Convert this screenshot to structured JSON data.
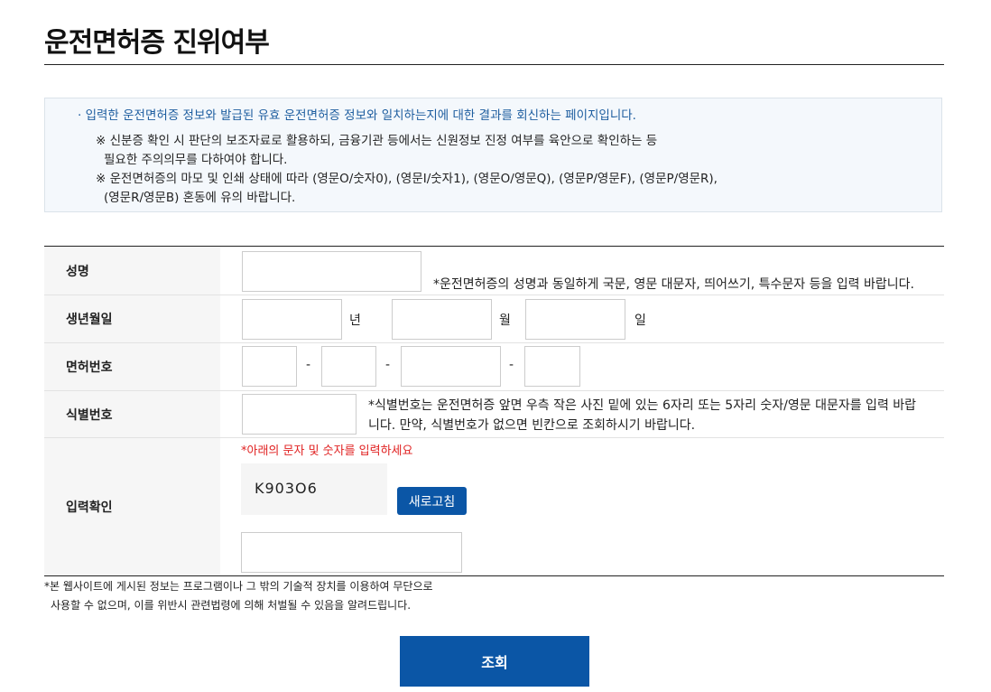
{
  "page": {
    "title": "운전면허증 진위여부"
  },
  "notice": {
    "lead": "· 입력한 운전면허증 정보와 발급된 유효 운전면허증 정보와 일치하는지에 대한 결과를 회신하는 페이지입니다.",
    "lines": [
      "※ 신분증 확인 시 판단의 보조자료로 활용하되, 금융기관 등에서는 신원정보 진정 여부를 육안으로 확인하는 등",
      "필요한 주의의무를 다하여야 합니다.",
      "※ 운전면허증의 마모 및 인쇄 상태에 따라 (영문O/숫자0), (영문I/숫자1), (영문O/영문Q), (영문P/영문F), (영문P/영문R),",
      "(영문R/영문B) 혼동에 유의 바랍니다."
    ],
    "accent_color": "#1d5d9f"
  },
  "form": {
    "name": {
      "label": "성명",
      "value": "",
      "hint": "*운전면허증의 성명과 동일하게 국문, 영문 대문자, 띄어쓰기, 특수문자 등을 입력 바랍니다."
    },
    "birth": {
      "label": "생년월일",
      "year_value": "",
      "year_unit": "년",
      "month_value": "",
      "month_unit": "월",
      "day_value": "",
      "day_unit": "일"
    },
    "license": {
      "label": "면허번호",
      "values": [
        "",
        "",
        "",
        ""
      ],
      "separator": "-"
    },
    "serial": {
      "label": "식별번호",
      "value": "",
      "hint_lines": [
        "*식별번호는 운전면허증 앞면 우측 작은 사진 밑에 있는 6자리 또는 5자리 숫자/영문 대문자를 입력 바랍",
        "니다. 만약, 식별번호가 없으면 빈칸으로 조회하시기 바랍니다."
      ]
    },
    "captcha": {
      "label": "입력확인",
      "instruction": "*아래의 문자 및 숫자를 입력하세요",
      "code": "K903O6",
      "refresh_label": "새로고침",
      "value": ""
    }
  },
  "disclaimer": [
    "*본 웹사이트에 게시된 정보는 프로그램이나 그 밖의 기술적 장치를 이용하여 무단으로",
    "사용할 수 없으며, 이를 위반시 관련법령에 의해 처벌될 수 있음을 알려드립니다."
  ],
  "submit_label": "조회",
  "colors": {
    "primary": "#0b56a6",
    "warning": "#e02020",
    "label_bg": "#f6f6f6"
  }
}
